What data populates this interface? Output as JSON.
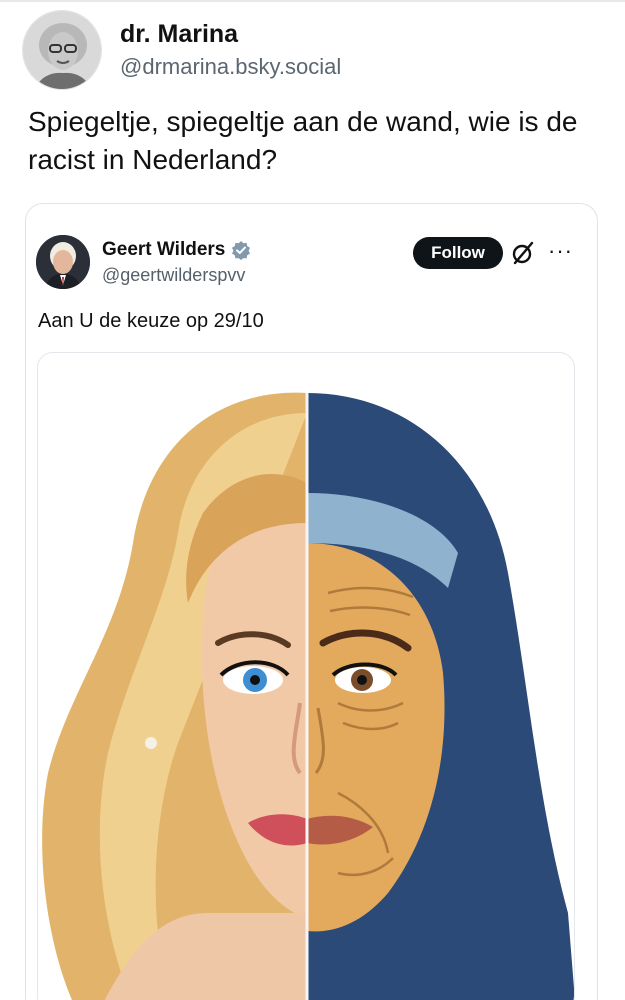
{
  "post": {
    "author_name": "dr. Marina",
    "author_handle": "@drmarina.bsky.social",
    "text": "Spiegeltje, spiegeltje aan de wand, wie is de racist in Nederland?"
  },
  "quoted_post": {
    "author_name": "Geert Wilders",
    "author_handle": "@geertwilderspvv",
    "follow_label": "Follow",
    "text": "Aan U de keuze op 29/10",
    "more_label": "···"
  },
  "colors": {
    "follow_bg": "#0f1419",
    "verified_badge": "#829aab",
    "hijab": "#2c4a78",
    "hair": "#e7c480"
  },
  "icons": [
    "verified-badge-icon",
    "grok-icon",
    "more-options-icon"
  ]
}
